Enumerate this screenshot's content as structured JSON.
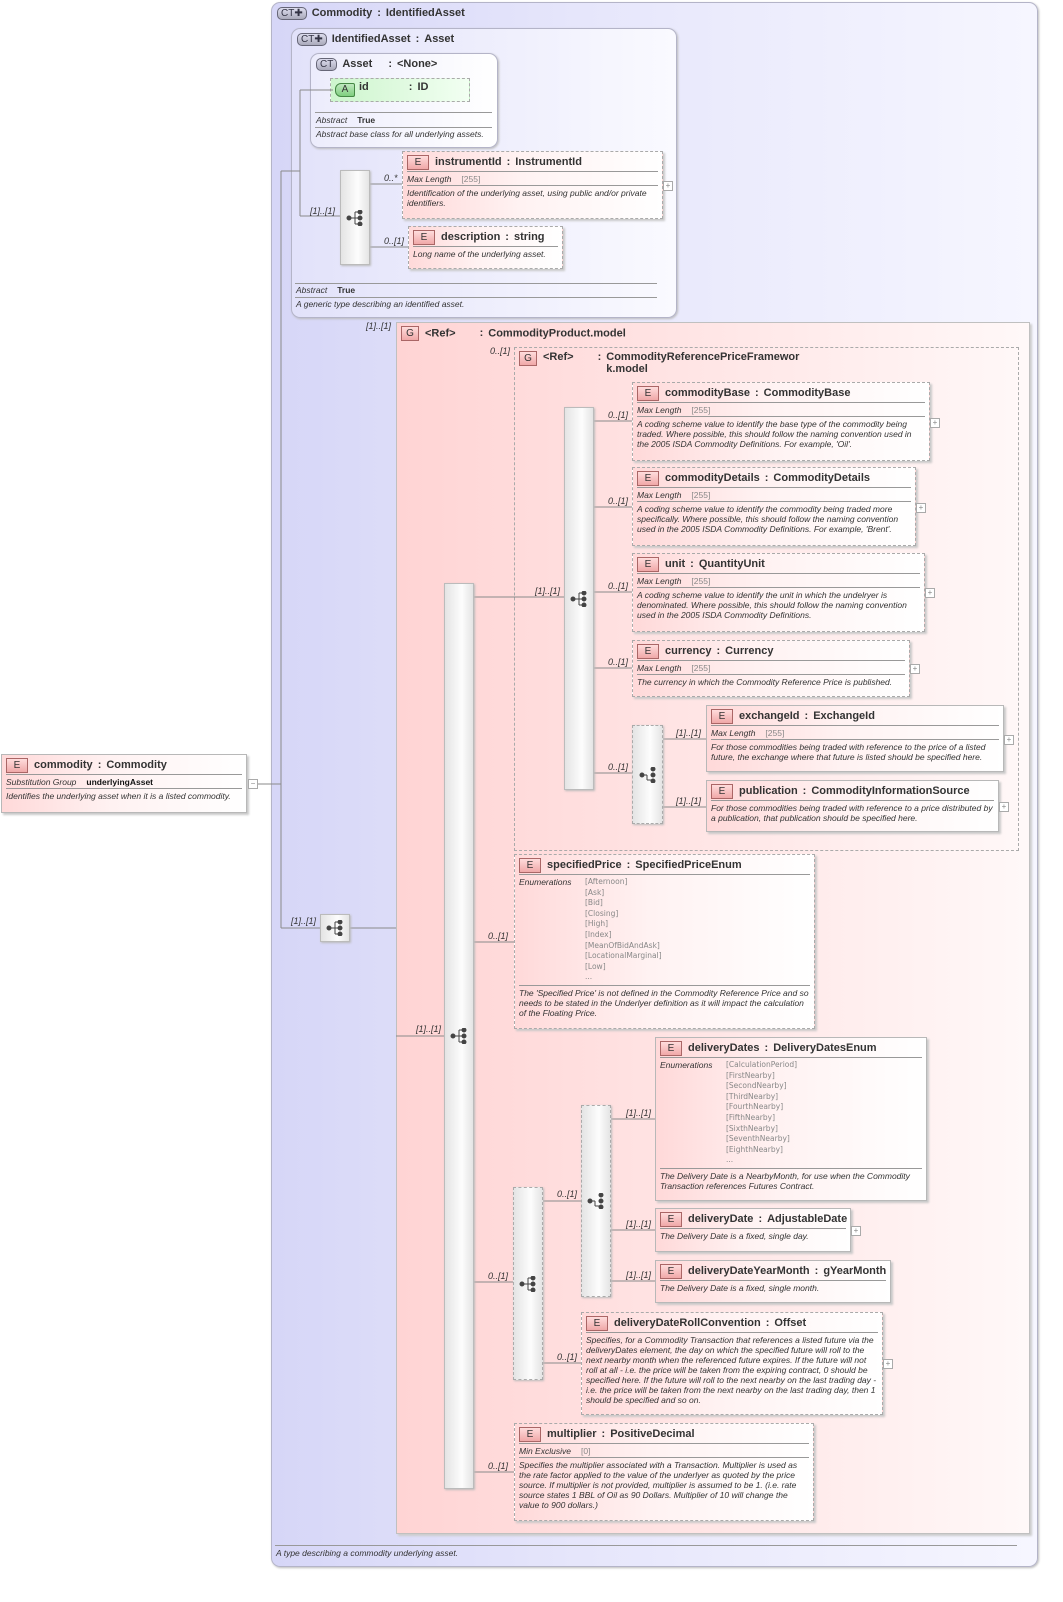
{
  "separator": ":",
  "root": {
    "badge": "E",
    "name": "commodity",
    "type": "Commodity",
    "props": [
      {
        "label": "Substitution Group",
        "value": "underlyingAsset",
        "dark": true
      }
    ],
    "doc": "Identifies the underlying asset when it is a listed commodity."
  },
  "commodity_type": {
    "badge": "CT✚",
    "name": "Commodity",
    "base": "IdentifiedAsset",
    "doc": "A type describing a commodity underlying asset."
  },
  "identified_asset": {
    "badge": "CT✚",
    "name": "IdentifiedAsset",
    "base": "Asset",
    "abstract_label": "Abstract",
    "abstract_value": "True",
    "doc": "A generic type describing an identified asset."
  },
  "asset": {
    "badge": "CT",
    "name": "Asset",
    "base": "<None>",
    "abstract_label": "Abstract",
    "abstract_value": "True",
    "doc": "Abstract base class for all underlying assets."
  },
  "id_attr": {
    "badge": "A",
    "name": "id",
    "type": "ID"
  },
  "cards": {
    "identified_seq": "[1]..[1]",
    "commodity_seq": "[1]..[1]",
    "product_group": "[1]..[1]",
    "product_seq": "[1]..[1]",
    "ref_group": "0..[1]",
    "ref_seq": "[1]..[1]",
    "exchange_choice": "0..[1]",
    "delivery_seq": "0..[1]",
    "delivery_choice": "0..[1]"
  },
  "product_group": {
    "badge": "G",
    "name": "<Ref>",
    "type": "CommodityProduct.model"
  },
  "ref_group": {
    "badge": "G",
    "name": "<Ref>",
    "type": "CommodityReferencePriceFramework.model"
  },
  "elements": {
    "instrumentId": {
      "badge": "E",
      "card": "0..*",
      "name": "instrumentId",
      "type": "InstrumentId",
      "props": [
        {
          "label": "Max Length",
          "value": "[255]"
        }
      ],
      "doc": "Identification of the underlying asset, using public and/or private identifiers."
    },
    "description": {
      "badge": "E",
      "card": "0..[1]",
      "name": "description",
      "type": "string",
      "doc": "Long name of the underlying asset."
    },
    "commodityBase": {
      "badge": "E",
      "card": "0..[1]",
      "name": "commodityBase",
      "type": "CommodityBase",
      "props": [
        {
          "label": "Max Length",
          "value": "[255]"
        }
      ],
      "doc": "A coding scheme value to identify the base type of the commodity being traded. Where possible, this should follow the naming convention used in the 2005 ISDA Commodity Definitions. For example, 'Oil'."
    },
    "commodityDetails": {
      "badge": "E",
      "card": "0..[1]",
      "name": "commodityDetails",
      "type": "CommodityDetails",
      "props": [
        {
          "label": "Max Length",
          "value": "[255]"
        }
      ],
      "doc": "A coding scheme value to identify the commodity being traded more specifically. Where possible, this should follow the naming convention used in the 2005 ISDA Commodity Definitions. For example, 'Brent'."
    },
    "unit": {
      "badge": "E",
      "card": "0..[1]",
      "name": "unit",
      "type": "QuantityUnit",
      "props": [
        {
          "label": "Max Length",
          "value": "[255]"
        }
      ],
      "doc": "A coding scheme value to identify the unit in which the undelryer is denominated. Where possible, this should follow the naming convention used in the 2005 ISDA Commodity Definitions."
    },
    "currency": {
      "badge": "E",
      "card": "0..[1]",
      "name": "currency",
      "type": "Currency",
      "props": [
        {
          "label": "Max Length",
          "value": "[255]"
        }
      ],
      "doc": "The currency in which the Commodity Reference Price is published."
    },
    "exchangeId": {
      "badge": "E",
      "card": "[1]..[1]",
      "name": "exchangeId",
      "type": "ExchangeId",
      "props": [
        {
          "label": "Max Length",
          "value": "[255]"
        }
      ],
      "doc": "For those commodities being traded with reference to the price of a listed future, the exchange where that future is listed should be specified here."
    },
    "publication": {
      "badge": "E",
      "card": "[1]..[1]",
      "name": "publication",
      "type": "CommodityInformationSource",
      "doc": "For those commodities being traded with reference to a price distributed by a publication, that publication should be specified here."
    },
    "specifiedPrice": {
      "badge": "E",
      "card": "0..[1]",
      "name": "specifiedPrice",
      "type": "SpecifiedPriceEnum",
      "enum_label": "Enumerations",
      "enums": [
        "[Afternoon]",
        "[Ask]",
        "[Bid]",
        "[Closing]",
        "[High]",
        "[Index]",
        "[MeanOfBidAndAsk]",
        "[LocationalMarginal]",
        "[Low]",
        "..."
      ],
      "doc": "The 'Specified Price' is not defined in the Commodity Reference Price and so needs to be stated in the Underlyer definition as it will impact the calculation of the Floating Price."
    },
    "deliveryDates": {
      "badge": "E",
      "card": "[1]..[1]",
      "name": "deliveryDates",
      "type": "DeliveryDatesEnum",
      "enum_label": "Enumerations",
      "enums": [
        "[CalculationPeriod]",
        "[FirstNearby]",
        "[SecondNearby]",
        "[ThirdNearby]",
        "[FourthNearby]",
        "[FifthNearby]",
        "[SixthNearby]",
        "[SeventhNearby]",
        "[EighthNearby]",
        "..."
      ],
      "doc": "The Delivery Date is a NearbyMonth, for use when the Commodity Transaction references Futures Contract."
    },
    "deliveryDate": {
      "badge": "E",
      "card": "[1]..[1]",
      "name": "deliveryDate",
      "type": "AdjustableDate",
      "doc": "The Delivery Date is a fixed, single day."
    },
    "deliveryDateYearMonth": {
      "badge": "E",
      "card": "[1]..[1]",
      "name": "deliveryDateYearMonth",
      "type": "gYearMonth",
      "doc": "The Delivery Date is a fixed, single month."
    },
    "deliveryDateRollConvention": {
      "badge": "E",
      "card": "0..[1]",
      "name": "deliveryDateRollConvention",
      "type": "Offset",
      "doc": "Specifies, for a Commodity Transaction that references a listed future via the deliveryDates element, the day on which the specified future will roll to the next nearby month when the referenced future expires. If the future will not roll at all - i.e. the price will be taken from the expiring contract, 0 should be specified here. If the future will roll to the next nearby on the last trading day - i.e. the price will be taken from the next nearby on the last trading day, then 1 should be specified and so on."
    },
    "multiplier": {
      "badge": "E",
      "card": "0..[1]",
      "name": "multiplier",
      "type": "PositiveDecimal",
      "props": [
        {
          "label": "Min Exclusive",
          "value": "[0]"
        }
      ],
      "doc": "Specifies the multiplier associated with a Transaction. Multiplier is used as the rate factor applied to the value of the underlyer as quoted by the price source. If multiplier is not provided, multiplier is assumed to be 1. (i.e. rate source states 1 BBL of Oil as 90 Dollars. Multiplier of 10 will change the value to 900 dollars.)"
    }
  }
}
